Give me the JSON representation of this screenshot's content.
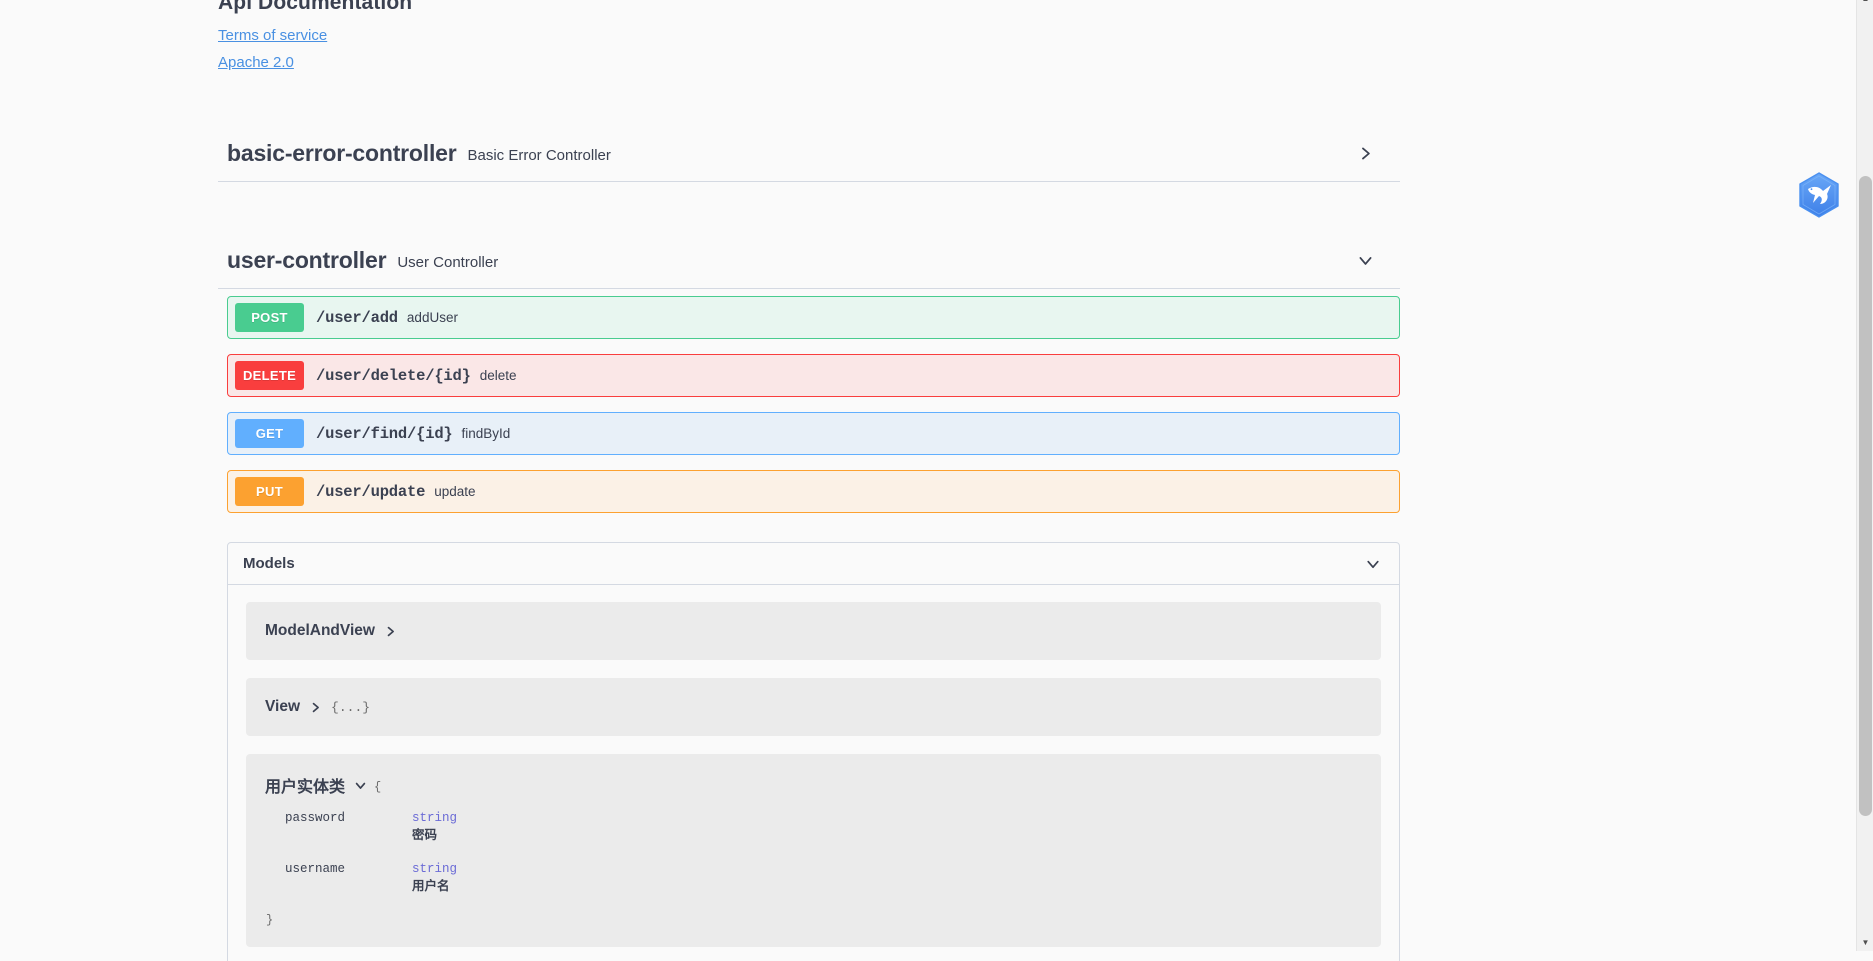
{
  "info": {
    "title": "Api Documentation",
    "links": [
      {
        "label": "Terms of service"
      },
      {
        "label": "Apache 2.0"
      }
    ]
  },
  "tags": [
    {
      "name": "basic-error-controller",
      "description": "Basic Error Controller",
      "expanded": false,
      "operations": []
    },
    {
      "name": "user-controller",
      "description": "User Controller",
      "expanded": true,
      "operations": [
        {
          "method": "POST",
          "method_class": "post",
          "path": "/user/add",
          "summary": "addUser"
        },
        {
          "method": "DELETE",
          "method_class": "delete",
          "path": "/user/delete/{id}",
          "summary": "delete"
        },
        {
          "method": "GET",
          "method_class": "get",
          "path": "/user/find/{id}",
          "summary": "findById"
        },
        {
          "method": "PUT",
          "method_class": "put",
          "path": "/user/update",
          "summary": "update"
        }
      ]
    }
  ],
  "models": {
    "title": "Models",
    "expanded": true,
    "items": [
      {
        "name": "ModelAndView",
        "expanded": false,
        "collapsed_braces": "",
        "properties": []
      },
      {
        "name": "View",
        "expanded": false,
        "collapsed_braces": "{...}",
        "properties": []
      },
      {
        "name": "用户实体类",
        "expanded": true,
        "open_brace": "{",
        "close_brace": "}",
        "properties": [
          {
            "name": "password",
            "type": "string",
            "description": "密码"
          },
          {
            "name": "username",
            "type": "string",
            "description": "用户名"
          }
        ]
      }
    ]
  },
  "colors": {
    "post": "#49cc90",
    "delete": "#f93e3e",
    "get": "#61affe",
    "put": "#fca130",
    "link": "#4990e2",
    "text": "#3b4151"
  },
  "float_widget": {
    "icon": "bird-hexagon-icon"
  }
}
